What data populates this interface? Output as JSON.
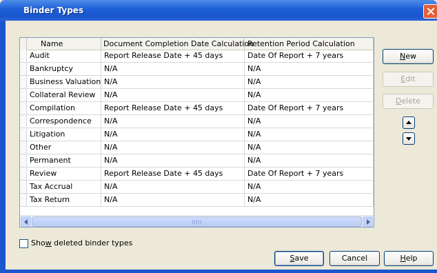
{
  "window": {
    "title": "Binder Types"
  },
  "grid": {
    "columns": [
      "Name",
      "Document Completion Date Calculation",
      "Retention Period Calculation"
    ],
    "rows": [
      [
        "Audit",
        "Report Release Date + 45 days",
        "Date Of Report + 7 years"
      ],
      [
        "Bankruptcy",
        "N/A",
        "N/A"
      ],
      [
        "Business Valuation",
        "N/A",
        "N/A"
      ],
      [
        "Collateral Review",
        "N/A",
        "N/A"
      ],
      [
        "Compilation",
        "Report Release Date + 45 days",
        "Date Of Report + 7 years"
      ],
      [
        "Correspondence",
        "N/A",
        "N/A"
      ],
      [
        "Litigation",
        "N/A",
        "N/A"
      ],
      [
        "Other",
        "N/A",
        "N/A"
      ],
      [
        "Permanent",
        "N/A",
        "N/A"
      ],
      [
        "Review",
        "Report Release Date + 45 days",
        "Date Of Report + 7 years"
      ],
      [
        "Tax Accrual",
        "N/A",
        "N/A"
      ],
      [
        "Tax Return",
        "N/A",
        "N/A"
      ]
    ]
  },
  "buttons": {
    "new": {
      "mnemonic": "N",
      "rest": "ew"
    },
    "edit": {
      "mnemonic": "E",
      "rest": "dit"
    },
    "delete": {
      "mnemonic": "D",
      "rest": "elete"
    },
    "save": {
      "mnemonic": "S",
      "rest": "ave"
    },
    "cancel": "Cancel",
    "help": {
      "mnemonic": "H",
      "rest": "elp"
    }
  },
  "show_deleted": {
    "before": "Sho",
    "mnemonic": "w",
    "after": " deleted binder types",
    "checked": false
  },
  "colors": {
    "titlebar": "#1b56cc",
    "dialog_bg": "#ece9d8",
    "close": "#e35e37"
  },
  "icons": [
    "close-icon",
    "scroll-left-arrow-icon",
    "scroll-right-arrow-icon",
    "move-up-arrow-icon",
    "move-down-arrow-icon"
  ]
}
